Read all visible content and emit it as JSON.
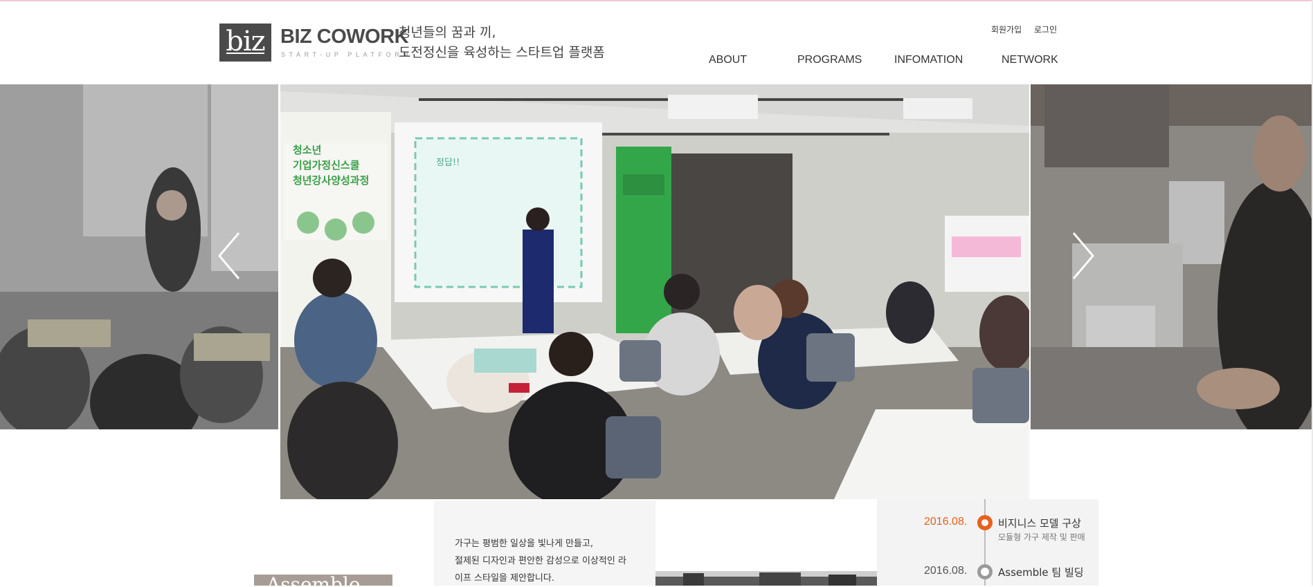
{
  "header": {
    "logo_text": "biz",
    "brand": "BIZ COWORK",
    "brand_sub": "START-UP PLATFORM",
    "slogan_line1": "청년들의 꿈과 끼,",
    "slogan_line2": "도전정신을 육성하는 스타트업 플랫폼",
    "signup": "회원가입",
    "login": "로그인"
  },
  "nav": {
    "about": "ABOUT",
    "programs": "PROGRAMS",
    "infomation": "INFOMATION",
    "network": "NETWORK"
  },
  "slider": {
    "main_banner_title_1": "청소년",
    "main_banner_title_2": "기업가정신스쿨",
    "main_banner_title_3": "청년강사양성과정",
    "screen_text": "정답!!"
  },
  "bottom": {
    "tag": "Assemble",
    "desc_line1": "가구는 평범한 일상을 빛나게 만들고,",
    "desc_line2": "절제된 디자인과 편안한 감성으로 이상적인 라",
    "desc_line3": "이프 스타일을 제안합니다.",
    "timeline": [
      {
        "date": "2016.08.",
        "title": "비지니스 모델 구상",
        "sub": "모듈형 가구 제작 및 판매"
      },
      {
        "date": "2016.08.",
        "title": "Assemble 팀 빌딩",
        "sub": ""
      }
    ]
  },
  "colors": {
    "accent": "#e8601c",
    "dark": "#4a4a4a",
    "timeline_bg": "#f3f3f3"
  }
}
